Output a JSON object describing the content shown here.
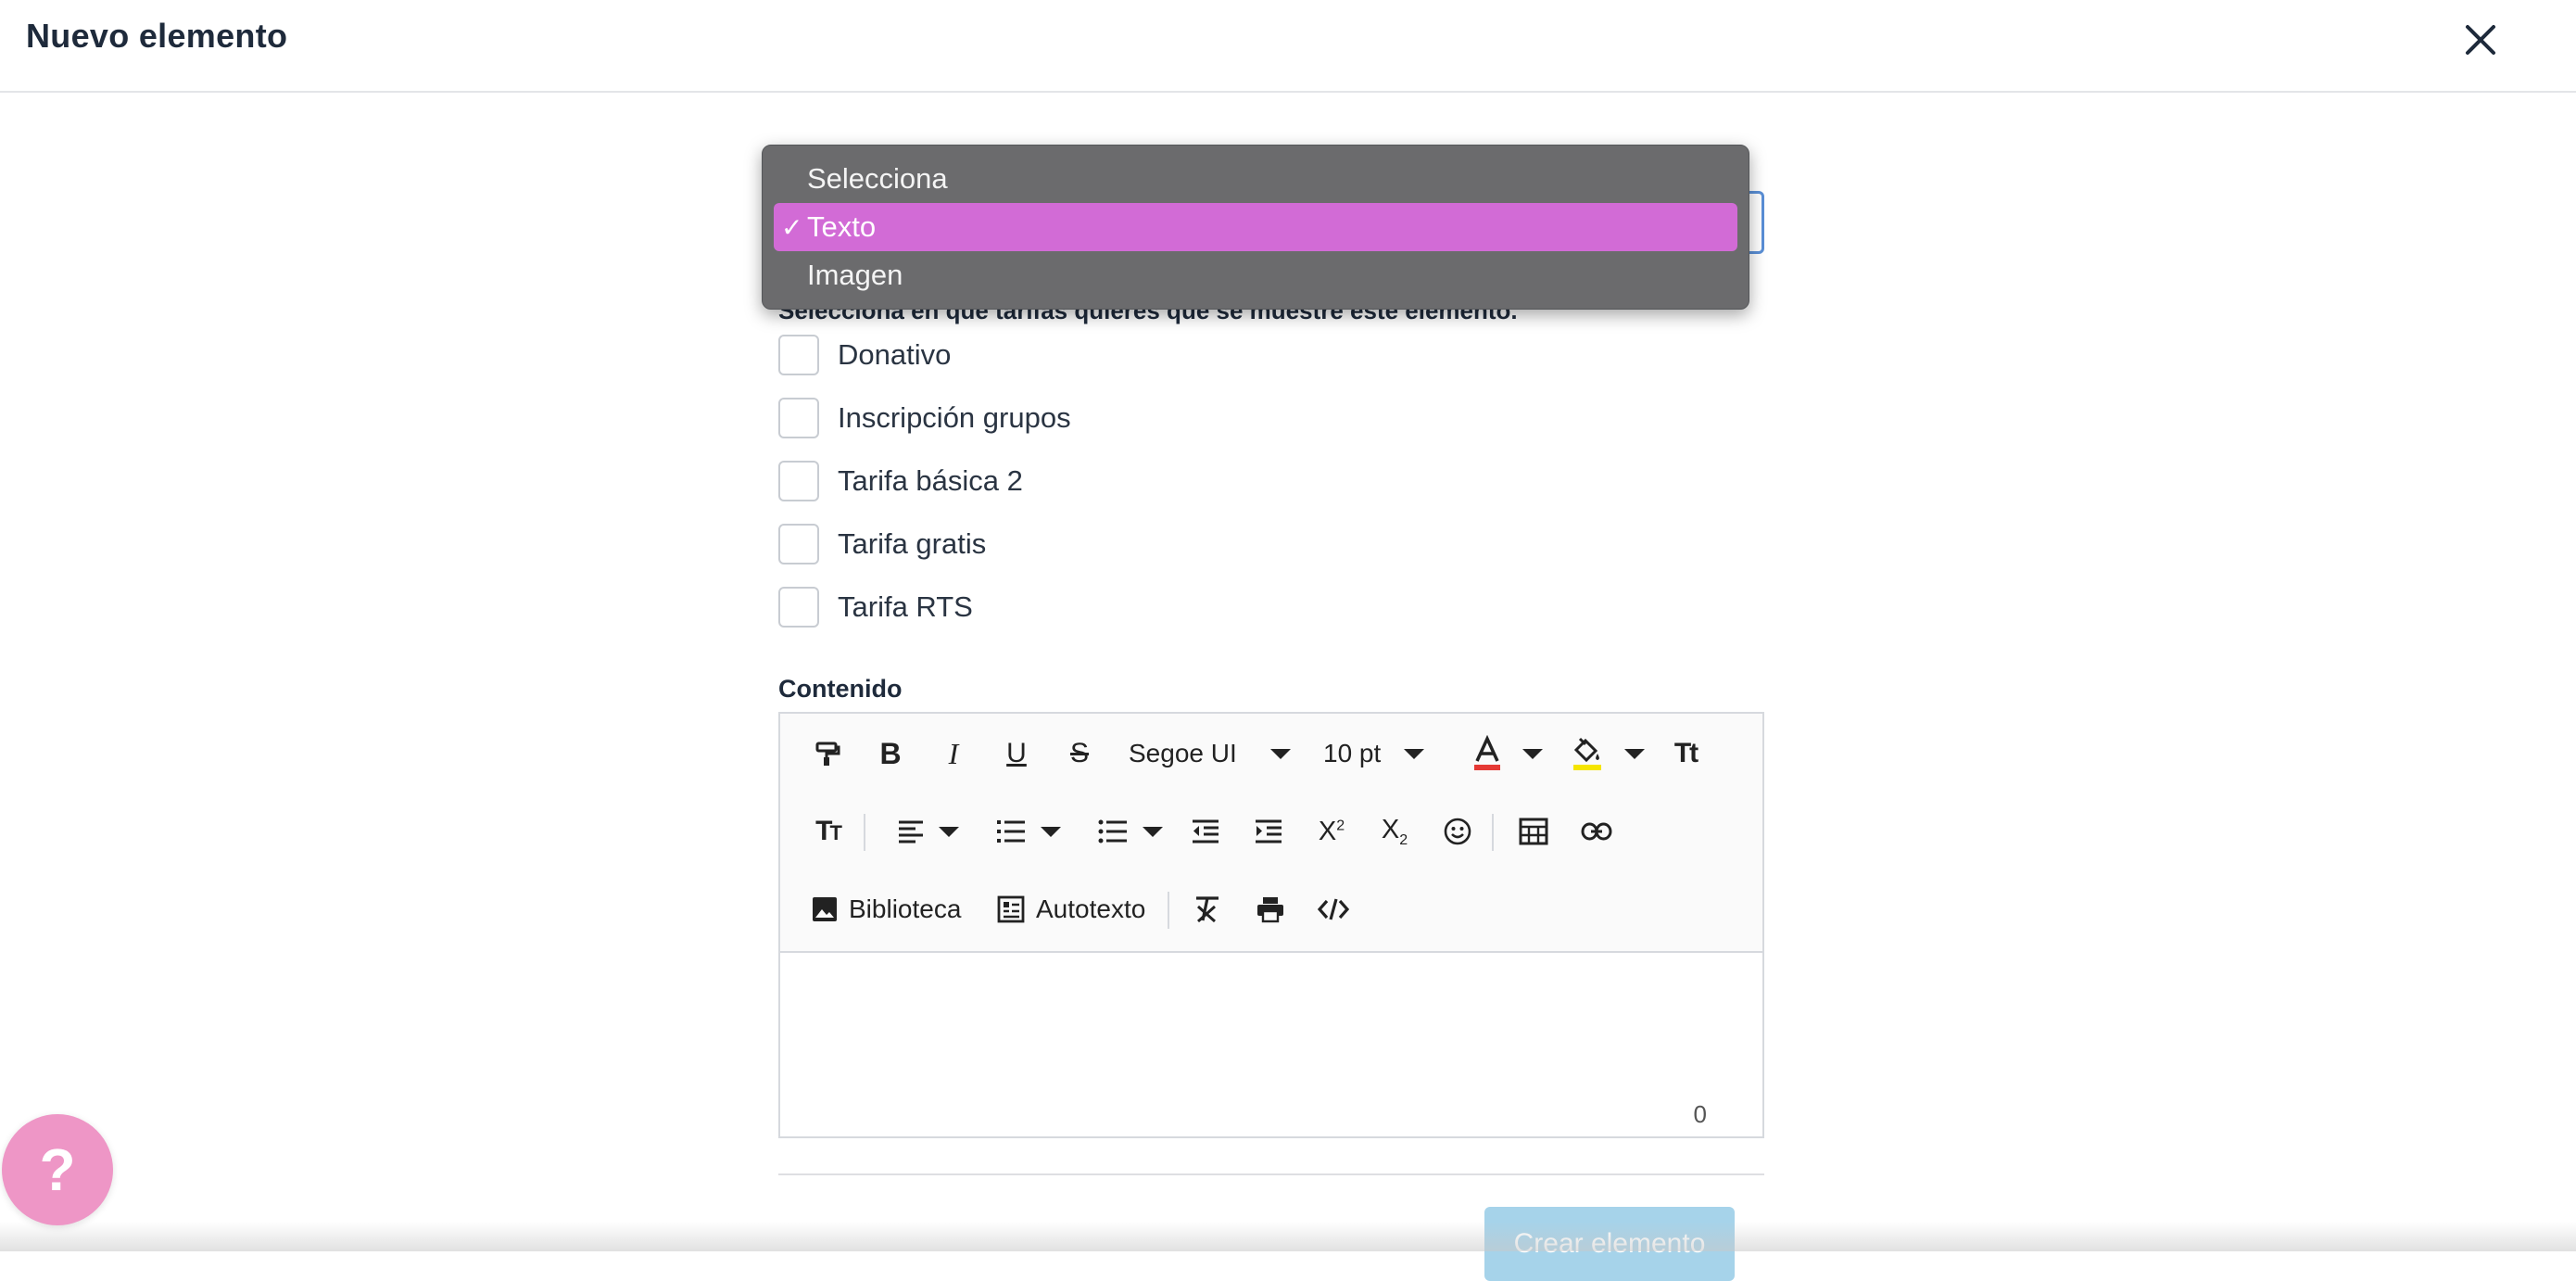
{
  "header": {
    "title": "Nuevo elemento"
  },
  "dropdown": {
    "options": [
      {
        "label": "Selecciona",
        "selected": false
      },
      {
        "label": "Texto",
        "selected": true
      },
      {
        "label": "Imagen",
        "selected": false
      }
    ],
    "check_mark": "✓",
    "highlight_color": "#d26bd6"
  },
  "tarifas": {
    "help_text": "Selecciona en que tarifas quieres que se muestre este elemento.",
    "items": [
      {
        "label": "Donativo",
        "checked": false
      },
      {
        "label": "Inscripción grupos",
        "checked": false
      },
      {
        "label": "Tarifa básica 2",
        "checked": false
      },
      {
        "label": "Tarifa gratis",
        "checked": false
      },
      {
        "label": "Tarifa RTS",
        "checked": false
      }
    ]
  },
  "content": {
    "label": "Contenido",
    "toolbar": {
      "font_family": "Segoe UI",
      "font_size": "10 pt",
      "library_label": "Biblioteca",
      "autotext_label": "Autotexto"
    },
    "char_count": "0"
  },
  "actions": {
    "create_label": "Crear elemento"
  },
  "help": {
    "symbol": "?"
  },
  "colors": {
    "accent_pink": "#d26bd6",
    "help_pink": "#ee96c6",
    "button_disabled": "#a6d3ea",
    "text_color_red": "#e53935",
    "highlight_yellow": "#f5e500"
  }
}
